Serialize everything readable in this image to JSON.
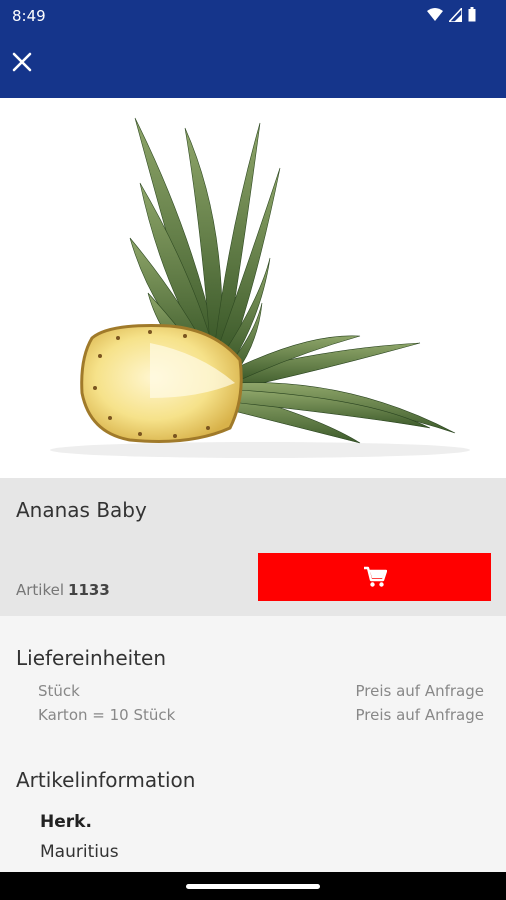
{
  "status_bar": {
    "time": "8:49",
    "icons": [
      "wifi-icon",
      "signal-icon",
      "battery-icon"
    ]
  },
  "app_bar": {
    "close_icon": "close-icon",
    "color": "#15358b"
  },
  "product": {
    "name": "Ananas Baby",
    "article_label": "Artikel",
    "article_number": "1133",
    "cart_icon": "shopping-cart-icon",
    "cart_button_color": "#ff0000"
  },
  "delivery_units": {
    "heading": "Liefereinheiten",
    "items": [
      {
        "name": "Stück",
        "price": "Preis auf Anfrage"
      },
      {
        "name": "Karton = 10 Stück",
        "price": "Preis auf Anfrage"
      }
    ]
  },
  "article_info": {
    "heading": "Artikelinformation",
    "label": "Herk.",
    "value": "Mauritius"
  }
}
